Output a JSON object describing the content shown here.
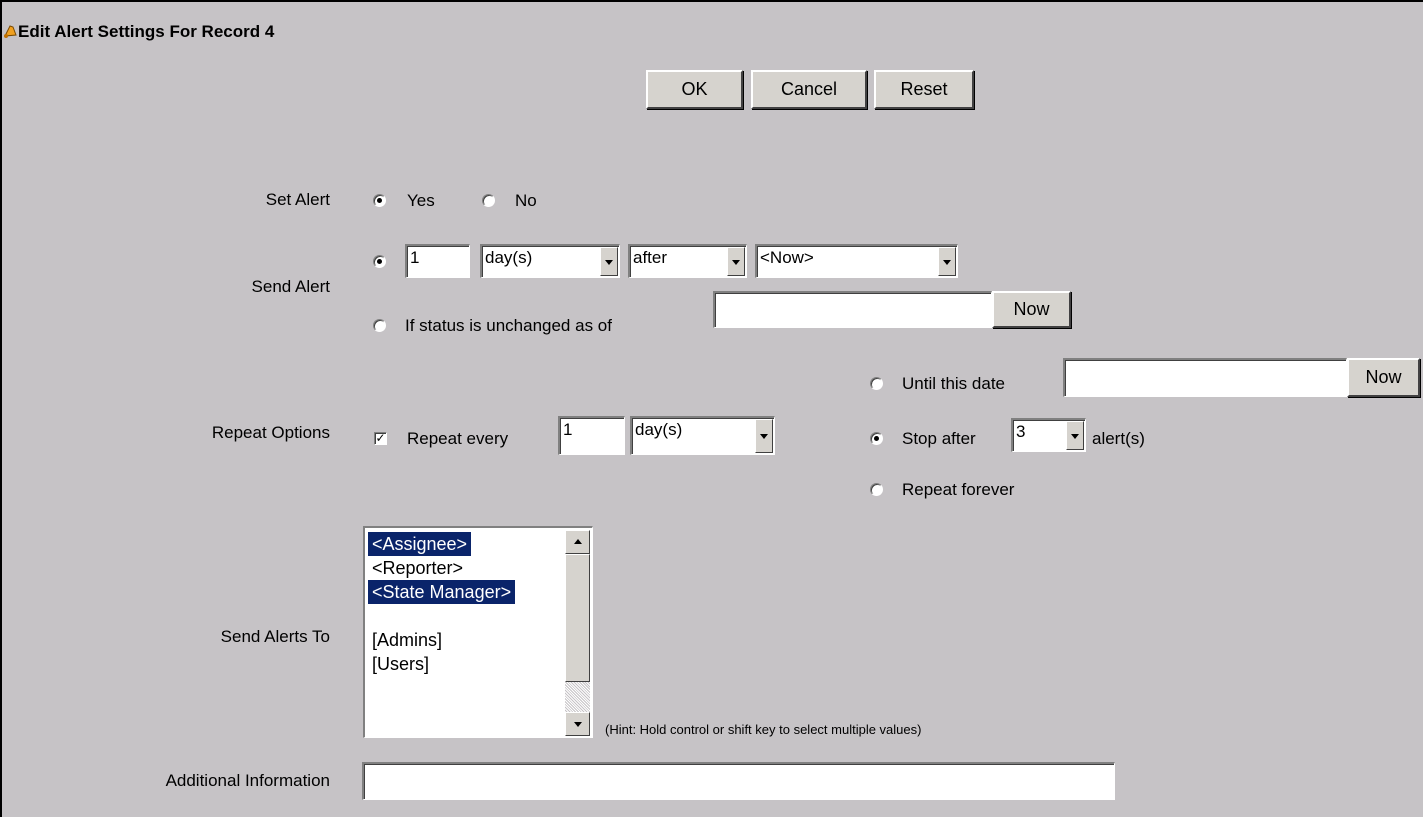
{
  "header": {
    "title": "Edit Alert Settings For Record 4"
  },
  "toolbar": {
    "ok": "OK",
    "cancel": "Cancel",
    "reset": "Reset"
  },
  "set_alert": {
    "label": "Set Alert",
    "yes": "Yes",
    "no": "No",
    "selected": "Yes"
  },
  "send_alert": {
    "label": "Send Alert",
    "amount": "1",
    "unit": "day(s)",
    "relation": "after",
    "reference": "<Now>",
    "status_text": "If status is unchanged as of",
    "status_date": "",
    "now_button": "Now",
    "selected": "relative"
  },
  "repeat": {
    "label": "Repeat Options",
    "checked": true,
    "repeat_text": "Repeat every",
    "interval": "1",
    "interval_unit": "day(s)",
    "until_text": "Until this date",
    "until_date": "",
    "now_button": "Now",
    "stop_text": "Stop after",
    "stop_count": "3",
    "alerts_text": "alert(s)",
    "forever_text": "Repeat forever",
    "selected": "stop_after"
  },
  "recipients": {
    "label": "Send Alerts To",
    "options": [
      {
        "text": "<Assignee>",
        "selected": true
      },
      {
        "text": "<Reporter>",
        "selected": false
      },
      {
        "text": "<State Manager>",
        "selected": true
      },
      {
        "text": "",
        "selected": false
      },
      {
        "text": "[Admins]",
        "selected": false
      },
      {
        "text": "[Users]",
        "selected": false
      }
    ],
    "hint": "(Hint: Hold control or shift key to select multiple values)"
  },
  "additional": {
    "label": "Additional Information",
    "value": ""
  },
  "colors": {
    "background": "#c6c3c6",
    "selection": "#0a246a"
  }
}
